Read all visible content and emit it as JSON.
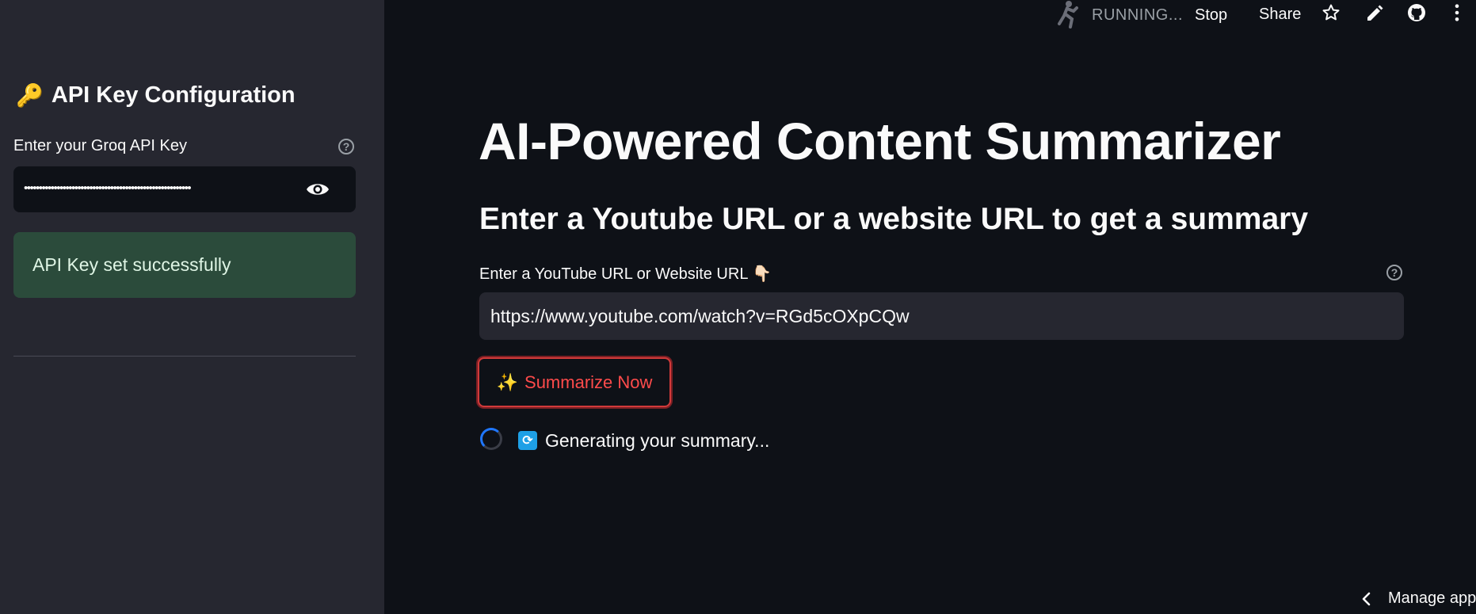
{
  "sidebar": {
    "title": "API Key Configuration",
    "title_icon": "key-icon",
    "api_key_label": "Enter your Groq API Key",
    "api_key_value": "••••••••••••••••••••••••••••••••••••••••••••••••••••••••",
    "success_message": "API Key set successfully"
  },
  "header": {
    "status": "RUNNING...",
    "stop_label": "Stop",
    "share_label": "Share",
    "icons": [
      "running-man-icon",
      "star-icon",
      "pencil-icon",
      "github-icon",
      "more-vertical-icon"
    ]
  },
  "main": {
    "title": "AI-Powered Content Summarizer",
    "subtitle": "Enter a Youtube URL or a website URL to get a summary",
    "url_label": "Enter a YouTube URL or Website URL 👇🏻",
    "url_value": "https://www.youtube.com/watch?v=RGd5cOXpCQw",
    "button_icon": "✨",
    "button_label": "Summarize Now",
    "status_text": "Generating your summary..."
  },
  "footer": {
    "manage_label": "Manage app"
  },
  "colors": {
    "background": "#0e1117",
    "sidebar": "#262730",
    "accent": "#ff4b4b",
    "success_bg": "#2b4b3b"
  }
}
